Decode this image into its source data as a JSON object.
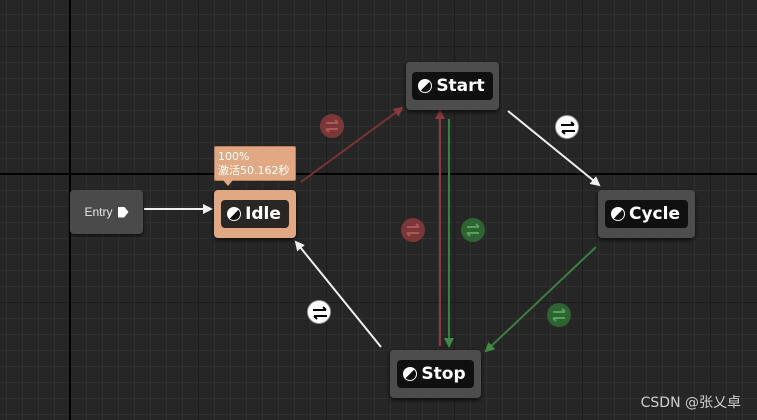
{
  "graph": {
    "entry": {
      "label": "Entry",
      "pin_icon": "output-pin-icon"
    },
    "states": [
      {
        "id": "idle",
        "label": "Idle",
        "active": true,
        "icon": "state-icon"
      },
      {
        "id": "start",
        "label": "Start",
        "active": false,
        "icon": "state-icon"
      },
      {
        "id": "cycle",
        "label": "Cycle",
        "active": false,
        "icon": "state-icon"
      },
      {
        "id": "stop",
        "label": "Stop",
        "active": false,
        "icon": "state-icon"
      }
    ],
    "active_tooltip": {
      "weight": "100%",
      "time": "激活50.162秒"
    },
    "transitions": [
      {
        "from": "Entry",
        "to": "Idle",
        "style": "default"
      },
      {
        "from": "Idle",
        "to": "Start",
        "style": "red"
      },
      {
        "from": "Start",
        "to": "Cycle",
        "style": "white"
      },
      {
        "from": "Cycle",
        "to": "Stop",
        "style": "green"
      },
      {
        "from": "Start",
        "to": "Stop",
        "style": "green"
      },
      {
        "from": "Stop",
        "to": "Start",
        "style": "red"
      },
      {
        "from": "Stop",
        "to": "Idle",
        "style": "white"
      }
    ],
    "colors": {
      "active_state": "#e0a983",
      "state": "#4d4d4d",
      "red_transition": "#8a3a3a",
      "green_transition": "#2f6a34",
      "background": "#262626"
    }
  },
  "watermark": "CSDN @张乂卓"
}
